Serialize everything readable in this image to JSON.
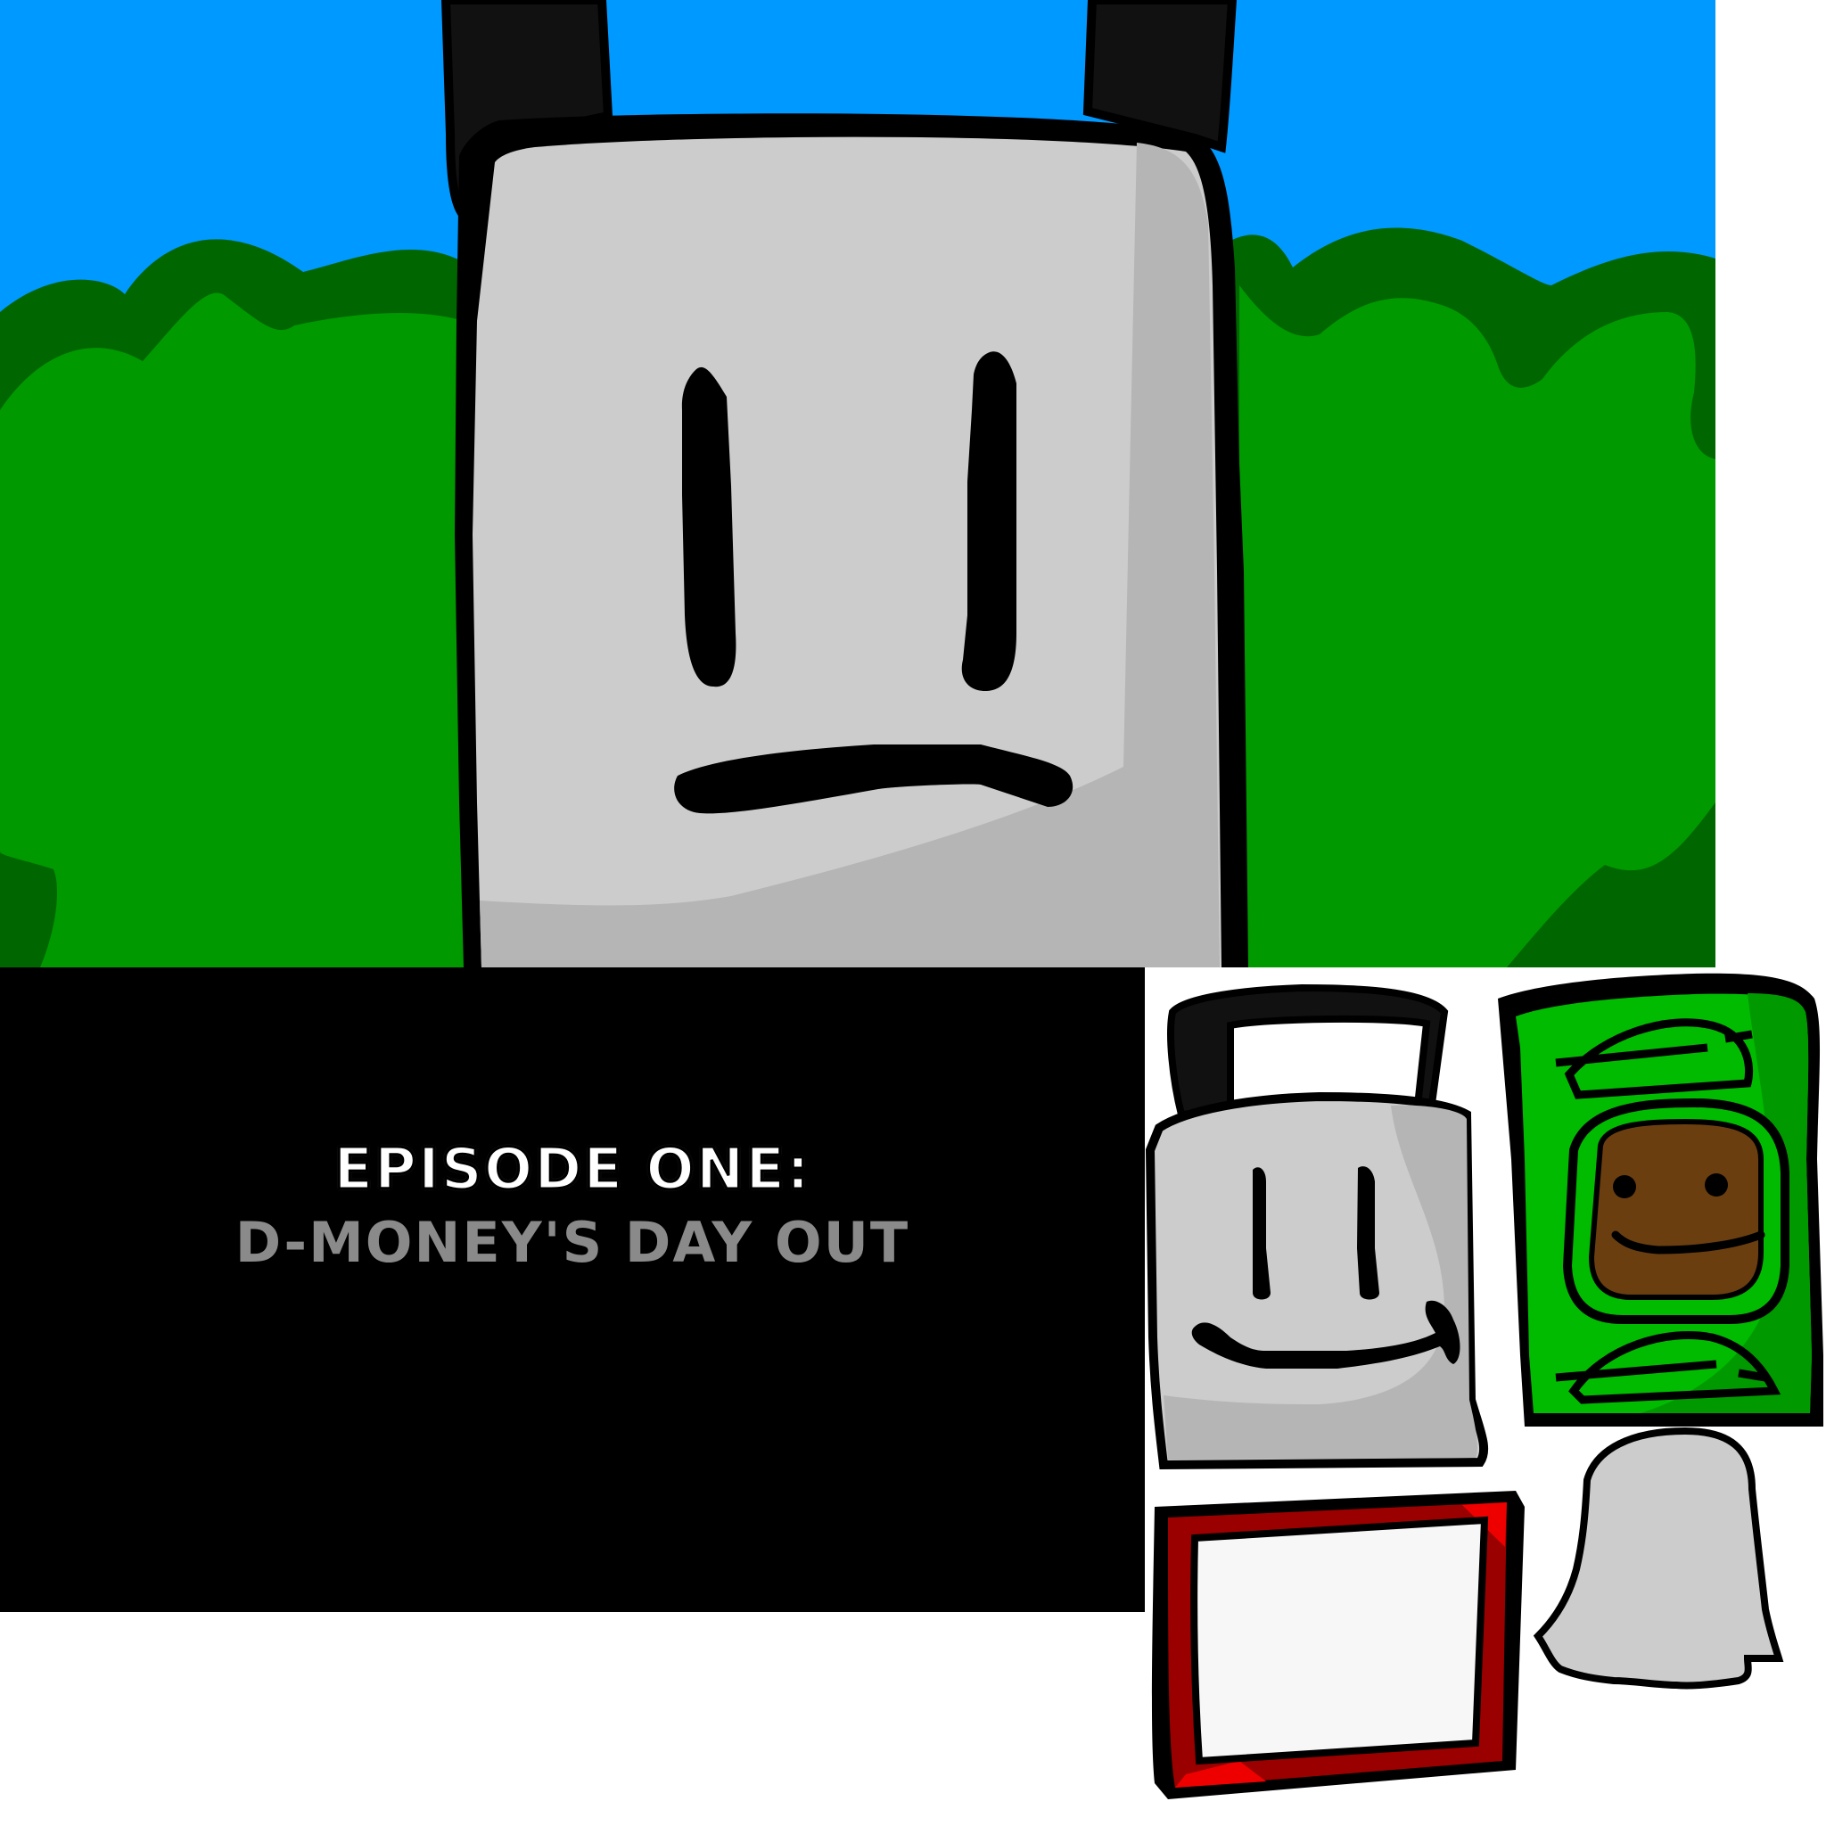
{
  "title_card": {
    "episode_number": "EPISODE ONE:",
    "episode_title": "D-MONEY'S DAY OUT"
  },
  "colors": {
    "sky": "#0099ff",
    "bush_dark": "#006600",
    "bush_light": "#009900",
    "body_gray": "#cccccc",
    "body_shade": "#b5b5b5",
    "outline": "#000000",
    "bill_green": "#00bb00",
    "coin_brown": "#6b3e10",
    "frame_red": "#9a0000"
  },
  "sprites": [
    {
      "name": "gray-bag-character",
      "icon": "smiling-bag-icon"
    },
    {
      "name": "dollar-bill-character",
      "icon": "dollar-bill-icon"
    },
    {
      "name": "red-frame-character",
      "icon": "picture-frame-icon"
    },
    {
      "name": "ghost-sheet-character",
      "icon": "ghost-icon"
    }
  ]
}
